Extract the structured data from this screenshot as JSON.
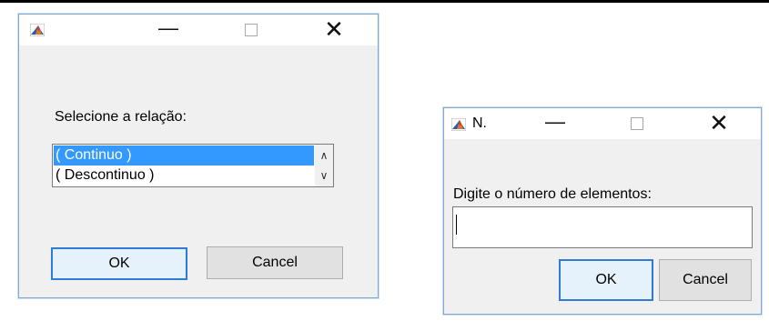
{
  "dialog1": {
    "prompt": "Selecione a relação:",
    "list_items": [
      "( Continuo )",
      "( Descontinuo )"
    ],
    "selected_index": 0,
    "ok_label": "OK",
    "cancel_label": "Cancel"
  },
  "dialog2": {
    "title": "N.",
    "prompt": "Digite o número de elementos:",
    "input_value": "",
    "ok_label": "OK",
    "cancel_label": "Cancel"
  },
  "icons": {
    "app": "matlab-icon",
    "minimize": "minimize-icon",
    "maximize": "maximize-icon",
    "close": "close-icon",
    "scroll_up": "chevron-up-icon",
    "scroll_down": "chevron-down-icon"
  },
  "colors": {
    "selection": "#3399ff",
    "default_button_border": "#2f7bd6",
    "dialog_bg": "#f0f0f0"
  }
}
